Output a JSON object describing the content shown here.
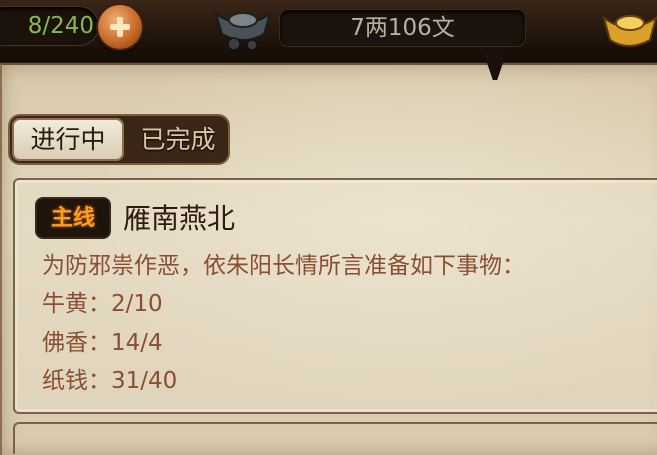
{
  "topbar": {
    "stamina": "8/240",
    "currency": "7两106文"
  },
  "tabs": {
    "active": "进行中",
    "inactive": "已完成"
  },
  "quest": {
    "badge": "主线",
    "title": "雁南燕北",
    "description": "为防邪祟作恶，依朱阳长情所言准备如下事物：",
    "requirements": [
      {
        "text": "牛黄：2/10"
      },
      {
        "text": "佛香：14/4"
      },
      {
        "text": "纸钱：31/40"
      }
    ]
  },
  "colors": {
    "stamina": "#86b84f",
    "badge_text": "#f7a21b",
    "requirement_text": "#8a4f32",
    "parchment": "#e2d6bd"
  },
  "icons": [
    "plus-icon",
    "silver-ingot-icon",
    "gold-ingot-icon"
  ]
}
